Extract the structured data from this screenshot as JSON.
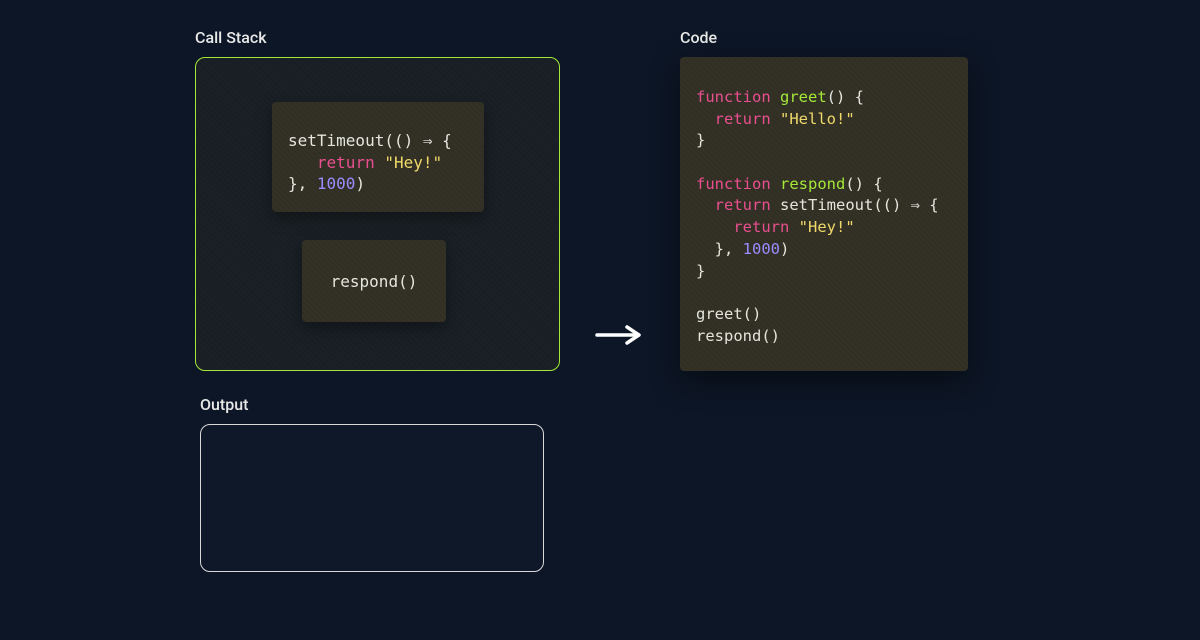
{
  "labels": {
    "callstack": "Call Stack",
    "output": "Output",
    "code": "Code"
  },
  "callstack": {
    "frame_top": {
      "tokens": [
        {
          "t": "plain",
          "v": "setTimeout(() ⇒ {\n   "
        },
        {
          "t": "kw",
          "v": "return"
        },
        {
          "t": "plain",
          "v": " "
        },
        {
          "t": "str",
          "v": "\"Hey!\""
        },
        {
          "t": "plain",
          "v": "\n}, "
        },
        {
          "t": "num",
          "v": "1000"
        },
        {
          "t": "plain",
          "v": ")"
        }
      ]
    },
    "frame_bottom": {
      "text": "respond()"
    }
  },
  "code": {
    "tokens": [
      {
        "t": "kw",
        "v": "function"
      },
      {
        "t": "plain",
        "v": " "
      },
      {
        "t": "fn",
        "v": "greet"
      },
      {
        "t": "plain",
        "v": "() {\n  "
      },
      {
        "t": "kw",
        "v": "return"
      },
      {
        "t": "plain",
        "v": " "
      },
      {
        "t": "str",
        "v": "\"Hello!\""
      },
      {
        "t": "plain",
        "v": "\n}\n\n"
      },
      {
        "t": "kw",
        "v": "function"
      },
      {
        "t": "plain",
        "v": " "
      },
      {
        "t": "fn",
        "v": "respond"
      },
      {
        "t": "plain",
        "v": "() {\n  "
      },
      {
        "t": "kw",
        "v": "return"
      },
      {
        "t": "plain",
        "v": " setTimeout(() ⇒ {\n    "
      },
      {
        "t": "kw",
        "v": "return"
      },
      {
        "t": "plain",
        "v": " "
      },
      {
        "t": "str",
        "v": "\"Hey!\""
      },
      {
        "t": "plain",
        "v": "\n  }, "
      },
      {
        "t": "num",
        "v": "1000"
      },
      {
        "t": "plain",
        "v": ")\n}\n\n"
      },
      {
        "t": "plain",
        "v": "greet()\nrespond()"
      }
    ]
  },
  "colors": {
    "bg": "#0d1626",
    "callstack_border": "#a4e838",
    "output_border": "#d8d8d8",
    "frame_bg": "#312f24",
    "keyword": "#e94f8f",
    "function": "#a4e838",
    "string": "#f0d96a",
    "number": "#9a8cff",
    "text": "#e5e5de"
  }
}
